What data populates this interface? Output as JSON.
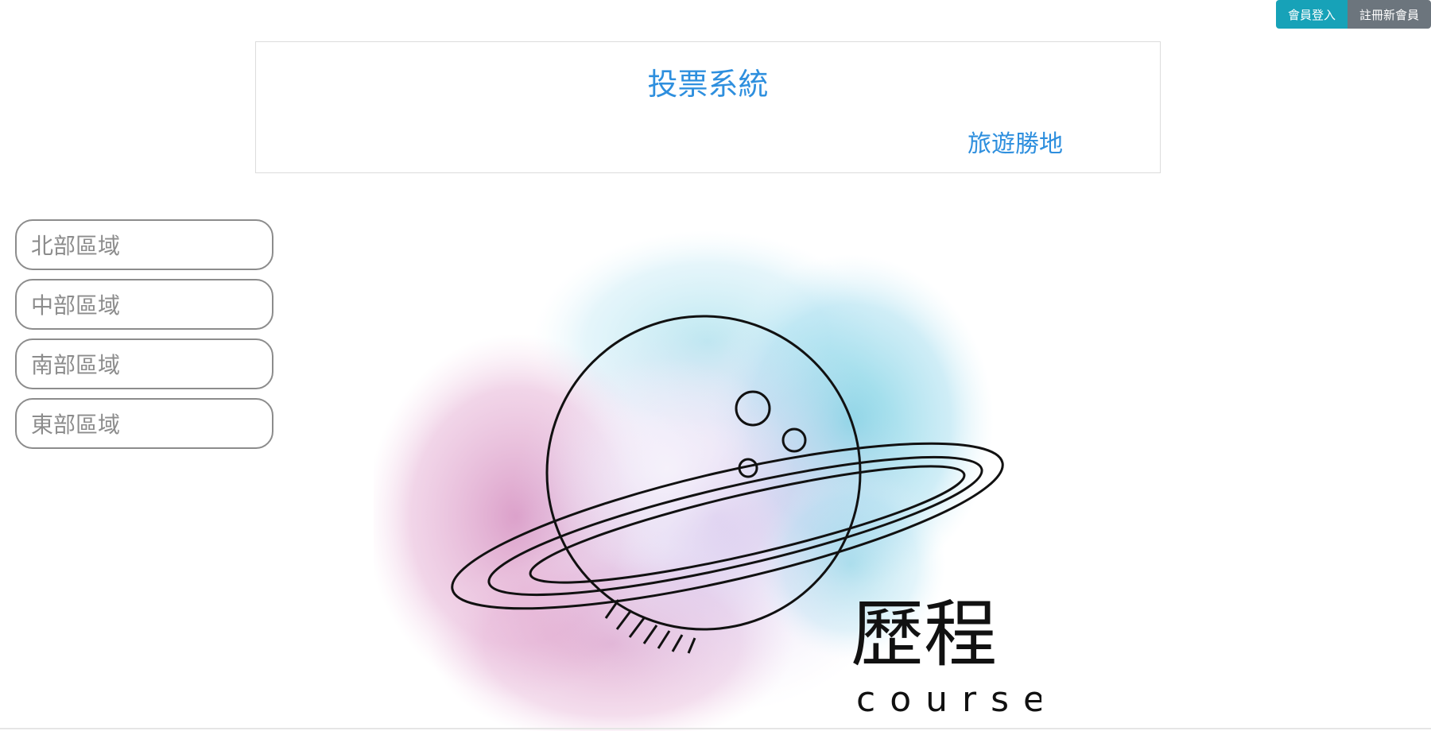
{
  "nav": {
    "login_label": "會員登入",
    "register_label": "註冊新會員",
    "login_color": "#17a2b8",
    "register_color": "#6c757d"
  },
  "header": {
    "title": "投票系統",
    "link_label": "旅遊勝地",
    "accent_color": "#2e8fde"
  },
  "sidebar": {
    "items": [
      {
        "label": "北部區域"
      },
      {
        "label": "中部區域"
      },
      {
        "label": "南部區域"
      },
      {
        "label": "東部區域"
      }
    ]
  },
  "hero": {
    "logo_text_cn": "歷程",
    "logo_text_en": "course"
  }
}
